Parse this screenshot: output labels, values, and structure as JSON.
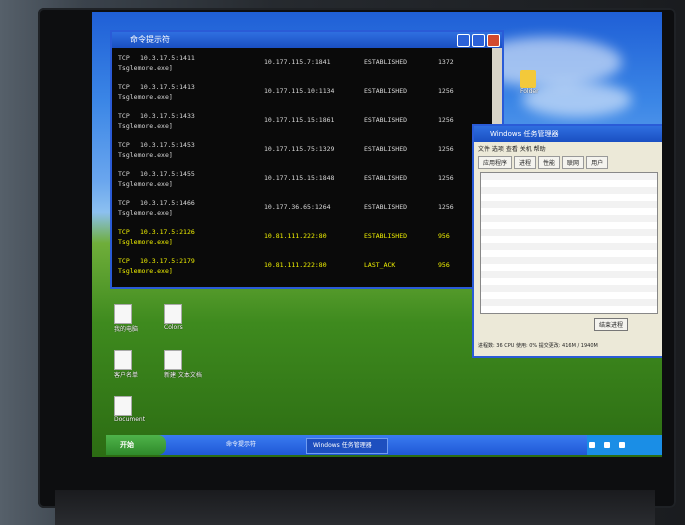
{
  "cmd_window": {
    "title": "命令提示符",
    "lines": [
      {
        "proto": "TCP",
        "local": "10.3.17.5:1411",
        "process": "Tsglemore.exe]",
        "remote": "10.177.115.7:1841",
        "state": "ESTABLISHED",
        "pid": "1372",
        "highlight": false
      },
      {
        "proto": "TCP",
        "local": "10.3.17.5:1413",
        "process": "Tsglemore.exe]",
        "remote": "10.177.115.10:1134",
        "state": "ESTABLISHED",
        "pid": "1256",
        "highlight": false
      },
      {
        "proto": "TCP",
        "local": "10.3.17.5:1433",
        "process": "Tsglemore.exe]",
        "remote": "10.177.115.15:1861",
        "state": "ESTABLISHED",
        "pid": "1256",
        "highlight": false
      },
      {
        "proto": "TCP",
        "local": "10.3.17.5:1453",
        "process": "Tsglemore.exe]",
        "remote": "10.177.115.75:1329",
        "state": "ESTABLISHED",
        "pid": "1256",
        "highlight": false
      },
      {
        "proto": "TCP",
        "local": "10.3.17.5:1455",
        "process": "Tsglemore.exe]",
        "remote": "10.177.115.15:1848",
        "state": "ESTABLISHED",
        "pid": "1256",
        "highlight": false
      },
      {
        "proto": "TCP",
        "local": "10.3.17.5:1466",
        "process": "Tsglemore.exe]",
        "remote": "10.177.36.65:1264",
        "state": "ESTABLISHED",
        "pid": "1256",
        "highlight": false
      },
      {
        "proto": "TCP",
        "local": "10.3.17.5:2126",
        "process": "Tsglemore.exe]",
        "remote": "10.81.111.222:80",
        "state": "ESTABLISHED",
        "pid": "956",
        "highlight": true
      },
      {
        "proto": "TCP",
        "local": "10.3.17.5:2179",
        "process": "Tsglemore.exe]",
        "remote": "10.81.111.222:80",
        "state": "LAST_ACK",
        "pid": "956",
        "highlight": true
      }
    ]
  },
  "task_manager": {
    "title": "Windows 任务管理器",
    "menu": "文件 选项 查看 关机 帮助",
    "tabs": [
      "应用程序",
      "进程",
      "性能",
      "联网",
      "用户"
    ],
    "end_button": "结束进程",
    "status": "进程数: 36 CPU 使用: 0% 提交更改: 416M / 1940M"
  },
  "desktop_icons": [
    {
      "name": "folder-top-right",
      "label": "Folder",
      "icon": "folder"
    },
    {
      "name": "icon-computer",
      "label": "我的电脑",
      "icon": "doc"
    },
    {
      "name": "icon-colorful",
      "label": "Colors",
      "icon": "doc"
    },
    {
      "name": "icon-shortcut-a",
      "label": "客户名单",
      "icon": "doc"
    },
    {
      "name": "icon-shortcut-b",
      "label": "新建 文本文档",
      "icon": "doc"
    },
    {
      "name": "icon-bottom",
      "label": "Document",
      "icon": "doc"
    }
  ],
  "taskbar": {
    "start_label": "开始",
    "quick_label": "命令提示符",
    "task_label": "Windows 任务管理器"
  }
}
